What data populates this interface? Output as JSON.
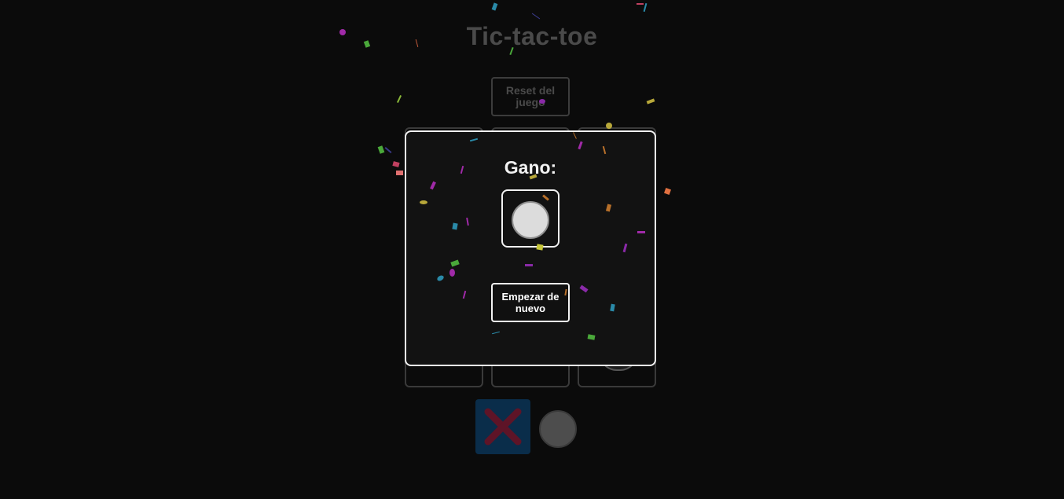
{
  "page": {
    "title": "Tic-tac-toe",
    "reset_label": "Reset del juego"
  },
  "turn": {
    "x_icon": "x-mark-icon",
    "o_icon": "circle-icon",
    "active": "x"
  },
  "modal": {
    "title": "Gano:",
    "winner_icon": "circle-icon",
    "restart_label": "Empezar de nuevo"
  },
  "colors": {
    "background": "#0b0b0b",
    "modal_bg": "#121212",
    "modal_border": "#f2f2f2",
    "x_color": "#5e1427",
    "x_turn_bg": "#0a2d4a",
    "o_color": "#dcdcdc",
    "dim_text": "#4a4a4a"
  }
}
